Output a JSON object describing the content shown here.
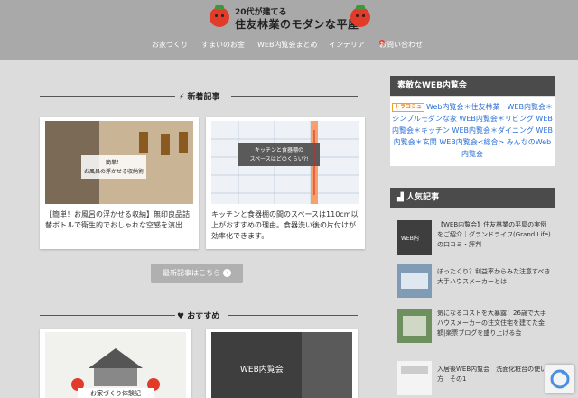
{
  "site": {
    "subtitle": "20代が建てる",
    "title": "住友林業のモダンな平屋"
  },
  "nav": {
    "items": [
      "お家づくり",
      "すまいのお金",
      "WEB内覧会まとめ",
      "インテリア",
      "お問い合わせ"
    ]
  },
  "new_posts": {
    "heading": "新着記事",
    "cards": [
      {
        "title": "【簡単！お風呂の浮かせる収納】無印良品詰替ボトルで衛生的でおしゃれな空感を演出",
        "thumb_caption": "簡単！\nお風呂の浮かせる収納術"
      },
      {
        "title": "キッチンと食器棚の間のスペースは110cm以上がおすすめの理由。食器洗い後の片付けが効率化できます。",
        "thumb_caption": "キッチンと食器棚の\nスペースはどのくらい?!"
      }
    ],
    "more_label": "最新記事はこちら"
  },
  "recommend": {
    "heading": "おすすめ",
    "cards": [
      {
        "thumb_caption": "お家づくり体験記"
      },
      {
        "thumb_caption": "WEB内覧会"
      }
    ]
  },
  "sidebar": {
    "web_heading": "素敵なWEB内覧会",
    "badge": "トラコミュ",
    "tags": "Web内覧会＊住友林業　WEB内覧会＊シンプルモダンな家 WEB内覧会＊リビング WEB内覧会＊キッチン WEB内覧会＊ダイニング WEB内覧会＊玄関 WEB内覧会<総合> みんなのWeb内覧会",
    "popular_heading": "人気記事",
    "popular": [
      {
        "title": "【WEB内覧会】住友林業の平屋の実例をご紹介｜グランドライフ(Grand Life)の口コミ・評判"
      },
      {
        "title": "ぼったくり？利益率からみた注意すべき大手ハウスメーカーとは"
      },
      {
        "title": "気になるコストを大暴露！26歳で大手ハウスメーカーの注文住宅を建てた金額|楽票ブログを盛り上げる会"
      },
      {
        "title": "入居後WEB内覧会　洗面化粧台の使い方　その1"
      }
    ]
  },
  "colors": {
    "header_bg": "#a9a9a9",
    "accent_red": "#e23b2a",
    "link_blue": "#2a6fd6",
    "side_head": "#4b4b4b"
  }
}
